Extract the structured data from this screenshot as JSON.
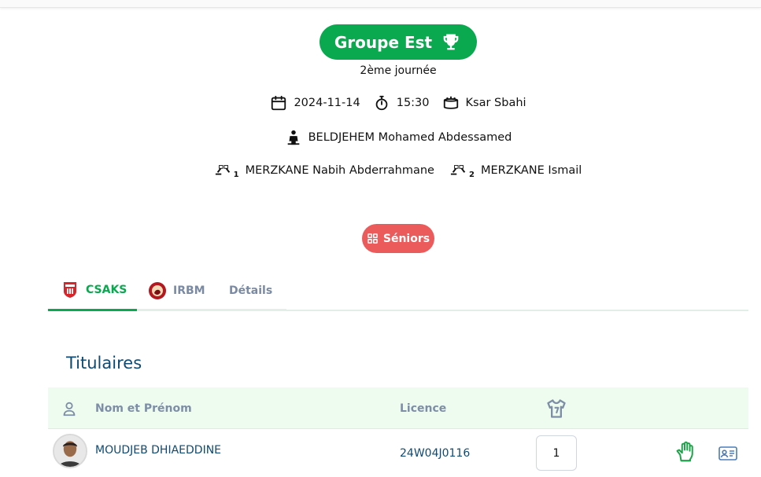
{
  "header": {
    "group_label": "Groupe Est",
    "journee": "2ème journée",
    "date": "2024-11-14",
    "time": "15:30",
    "stadium": "Ksar Sbahi",
    "referee": "BELDJEHEM Mohamed Abdessamed",
    "assistant1": "MERZKANE Nabih Abderrahmane",
    "assistant1_index": "1",
    "assistant2": "MERZKANE Ismail",
    "assistant2_index": "2"
  },
  "category": {
    "label": "Séniors"
  },
  "tabs": [
    {
      "label": "CSAKS",
      "active": true
    },
    {
      "label": "IRBM",
      "active": false
    },
    {
      "label": "Détails",
      "active": false
    }
  ],
  "lineup": {
    "title": "Titulaires",
    "columns": {
      "name": "Nom et Prénom",
      "licence": "Licence"
    },
    "players": [
      {
        "name": "MOUDJEB DHIAEDDINE",
        "licence": "24W04J0116",
        "number": "1",
        "role_icon": "goalkeeper-glove-icon"
      }
    ]
  },
  "colors": {
    "primary_green": "#0aa84f",
    "category_red": "#ec5b5b",
    "text_navy": "#0e4a73",
    "header_muted": "#7d8ea6",
    "table_header_bg": "#eefcf0"
  }
}
